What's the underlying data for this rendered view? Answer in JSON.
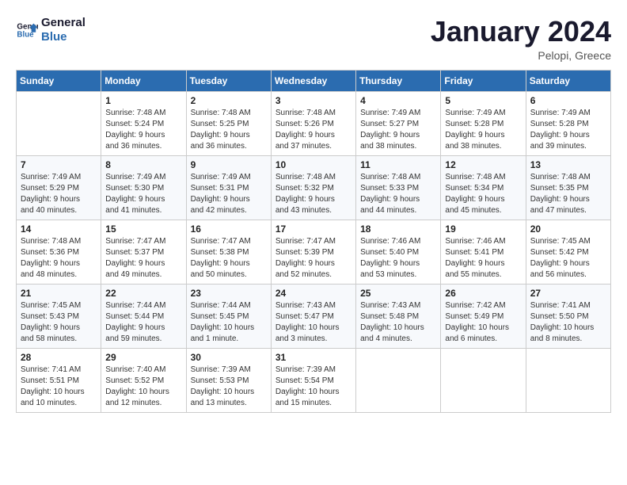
{
  "logo": {
    "text_general": "General",
    "text_blue": "Blue"
  },
  "title": "January 2024",
  "location": "Pelopi, Greece",
  "days_of_week": [
    "Sunday",
    "Monday",
    "Tuesday",
    "Wednesday",
    "Thursday",
    "Friday",
    "Saturday"
  ],
  "weeks": [
    [
      {
        "day": "",
        "info": ""
      },
      {
        "day": "1",
        "info": "Sunrise: 7:48 AM\nSunset: 5:24 PM\nDaylight: 9 hours\nand 36 minutes."
      },
      {
        "day": "2",
        "info": "Sunrise: 7:48 AM\nSunset: 5:25 PM\nDaylight: 9 hours\nand 36 minutes."
      },
      {
        "day": "3",
        "info": "Sunrise: 7:48 AM\nSunset: 5:26 PM\nDaylight: 9 hours\nand 37 minutes."
      },
      {
        "day": "4",
        "info": "Sunrise: 7:49 AM\nSunset: 5:27 PM\nDaylight: 9 hours\nand 38 minutes."
      },
      {
        "day": "5",
        "info": "Sunrise: 7:49 AM\nSunset: 5:28 PM\nDaylight: 9 hours\nand 38 minutes."
      },
      {
        "day": "6",
        "info": "Sunrise: 7:49 AM\nSunset: 5:28 PM\nDaylight: 9 hours\nand 39 minutes."
      }
    ],
    [
      {
        "day": "7",
        "info": "Sunrise: 7:49 AM\nSunset: 5:29 PM\nDaylight: 9 hours\nand 40 minutes."
      },
      {
        "day": "8",
        "info": "Sunrise: 7:49 AM\nSunset: 5:30 PM\nDaylight: 9 hours\nand 41 minutes."
      },
      {
        "day": "9",
        "info": "Sunrise: 7:49 AM\nSunset: 5:31 PM\nDaylight: 9 hours\nand 42 minutes."
      },
      {
        "day": "10",
        "info": "Sunrise: 7:48 AM\nSunset: 5:32 PM\nDaylight: 9 hours\nand 43 minutes."
      },
      {
        "day": "11",
        "info": "Sunrise: 7:48 AM\nSunset: 5:33 PM\nDaylight: 9 hours\nand 44 minutes."
      },
      {
        "day": "12",
        "info": "Sunrise: 7:48 AM\nSunset: 5:34 PM\nDaylight: 9 hours\nand 45 minutes."
      },
      {
        "day": "13",
        "info": "Sunrise: 7:48 AM\nSunset: 5:35 PM\nDaylight: 9 hours\nand 47 minutes."
      }
    ],
    [
      {
        "day": "14",
        "info": "Sunrise: 7:48 AM\nSunset: 5:36 PM\nDaylight: 9 hours\nand 48 minutes."
      },
      {
        "day": "15",
        "info": "Sunrise: 7:47 AM\nSunset: 5:37 PM\nDaylight: 9 hours\nand 49 minutes."
      },
      {
        "day": "16",
        "info": "Sunrise: 7:47 AM\nSunset: 5:38 PM\nDaylight: 9 hours\nand 50 minutes."
      },
      {
        "day": "17",
        "info": "Sunrise: 7:47 AM\nSunset: 5:39 PM\nDaylight: 9 hours\nand 52 minutes."
      },
      {
        "day": "18",
        "info": "Sunrise: 7:46 AM\nSunset: 5:40 PM\nDaylight: 9 hours\nand 53 minutes."
      },
      {
        "day": "19",
        "info": "Sunrise: 7:46 AM\nSunset: 5:41 PM\nDaylight: 9 hours\nand 55 minutes."
      },
      {
        "day": "20",
        "info": "Sunrise: 7:45 AM\nSunset: 5:42 PM\nDaylight: 9 hours\nand 56 minutes."
      }
    ],
    [
      {
        "day": "21",
        "info": "Sunrise: 7:45 AM\nSunset: 5:43 PM\nDaylight: 9 hours\nand 58 minutes."
      },
      {
        "day": "22",
        "info": "Sunrise: 7:44 AM\nSunset: 5:44 PM\nDaylight: 9 hours\nand 59 minutes."
      },
      {
        "day": "23",
        "info": "Sunrise: 7:44 AM\nSunset: 5:45 PM\nDaylight: 10 hours\nand 1 minute."
      },
      {
        "day": "24",
        "info": "Sunrise: 7:43 AM\nSunset: 5:47 PM\nDaylight: 10 hours\nand 3 minutes."
      },
      {
        "day": "25",
        "info": "Sunrise: 7:43 AM\nSunset: 5:48 PM\nDaylight: 10 hours\nand 4 minutes."
      },
      {
        "day": "26",
        "info": "Sunrise: 7:42 AM\nSunset: 5:49 PM\nDaylight: 10 hours\nand 6 minutes."
      },
      {
        "day": "27",
        "info": "Sunrise: 7:41 AM\nSunset: 5:50 PM\nDaylight: 10 hours\nand 8 minutes."
      }
    ],
    [
      {
        "day": "28",
        "info": "Sunrise: 7:41 AM\nSunset: 5:51 PM\nDaylight: 10 hours\nand 10 minutes."
      },
      {
        "day": "29",
        "info": "Sunrise: 7:40 AM\nSunset: 5:52 PM\nDaylight: 10 hours\nand 12 minutes."
      },
      {
        "day": "30",
        "info": "Sunrise: 7:39 AM\nSunset: 5:53 PM\nDaylight: 10 hours\nand 13 minutes."
      },
      {
        "day": "31",
        "info": "Sunrise: 7:39 AM\nSunset: 5:54 PM\nDaylight: 10 hours\nand 15 minutes."
      },
      {
        "day": "",
        "info": ""
      },
      {
        "day": "",
        "info": ""
      },
      {
        "day": "",
        "info": ""
      }
    ]
  ]
}
